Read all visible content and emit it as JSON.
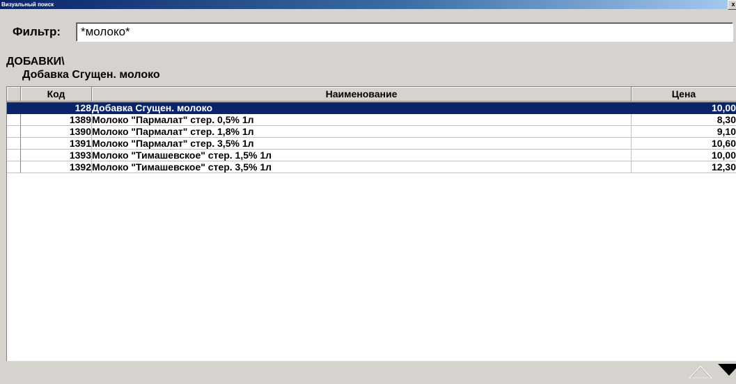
{
  "window": {
    "title": "Визуальный поиск",
    "close_label": "x"
  },
  "filter": {
    "label": "Фильтр:",
    "value": "*молоко*"
  },
  "path": {
    "breadcrumb": "ДОБАВКИ\\",
    "selected_item": "Добавка Сгущен. молоко"
  },
  "grid": {
    "columns": {
      "code": "Код",
      "name": "Наименование",
      "price": "Цена"
    },
    "rows": [
      {
        "code": "128",
        "name": "Добавка Сгущен. молоко",
        "price": "10,00",
        "selected": true
      },
      {
        "code": "1389",
        "name": "Молоко \"Пармалат\" стер. 0,5% 1л",
        "price": "8,30"
      },
      {
        "code": "1390",
        "name": "Молоко \"Пармалат\" стер. 1,8% 1л",
        "price": "9,10"
      },
      {
        "code": "1391",
        "name": "Молоко \"Пармалат\" стер. 3,5% 1л",
        "price": "10,60"
      },
      {
        "code": "1393",
        "name": "Молоко \"Тимашевское\" стер. 1,5% 1л",
        "price": "10,00"
      },
      {
        "code": "1392",
        "name": "Молоко \"Тимашевское\" стер. 3,5% 1л",
        "price": "12,30"
      }
    ]
  },
  "nav": {
    "up_icon": "triangle-up-icon",
    "down_icon": "triangle-down-icon"
  },
  "colors": {
    "selection": "#0a246a",
    "titlebar": "#0a246a",
    "background": "#d6d3ce"
  }
}
